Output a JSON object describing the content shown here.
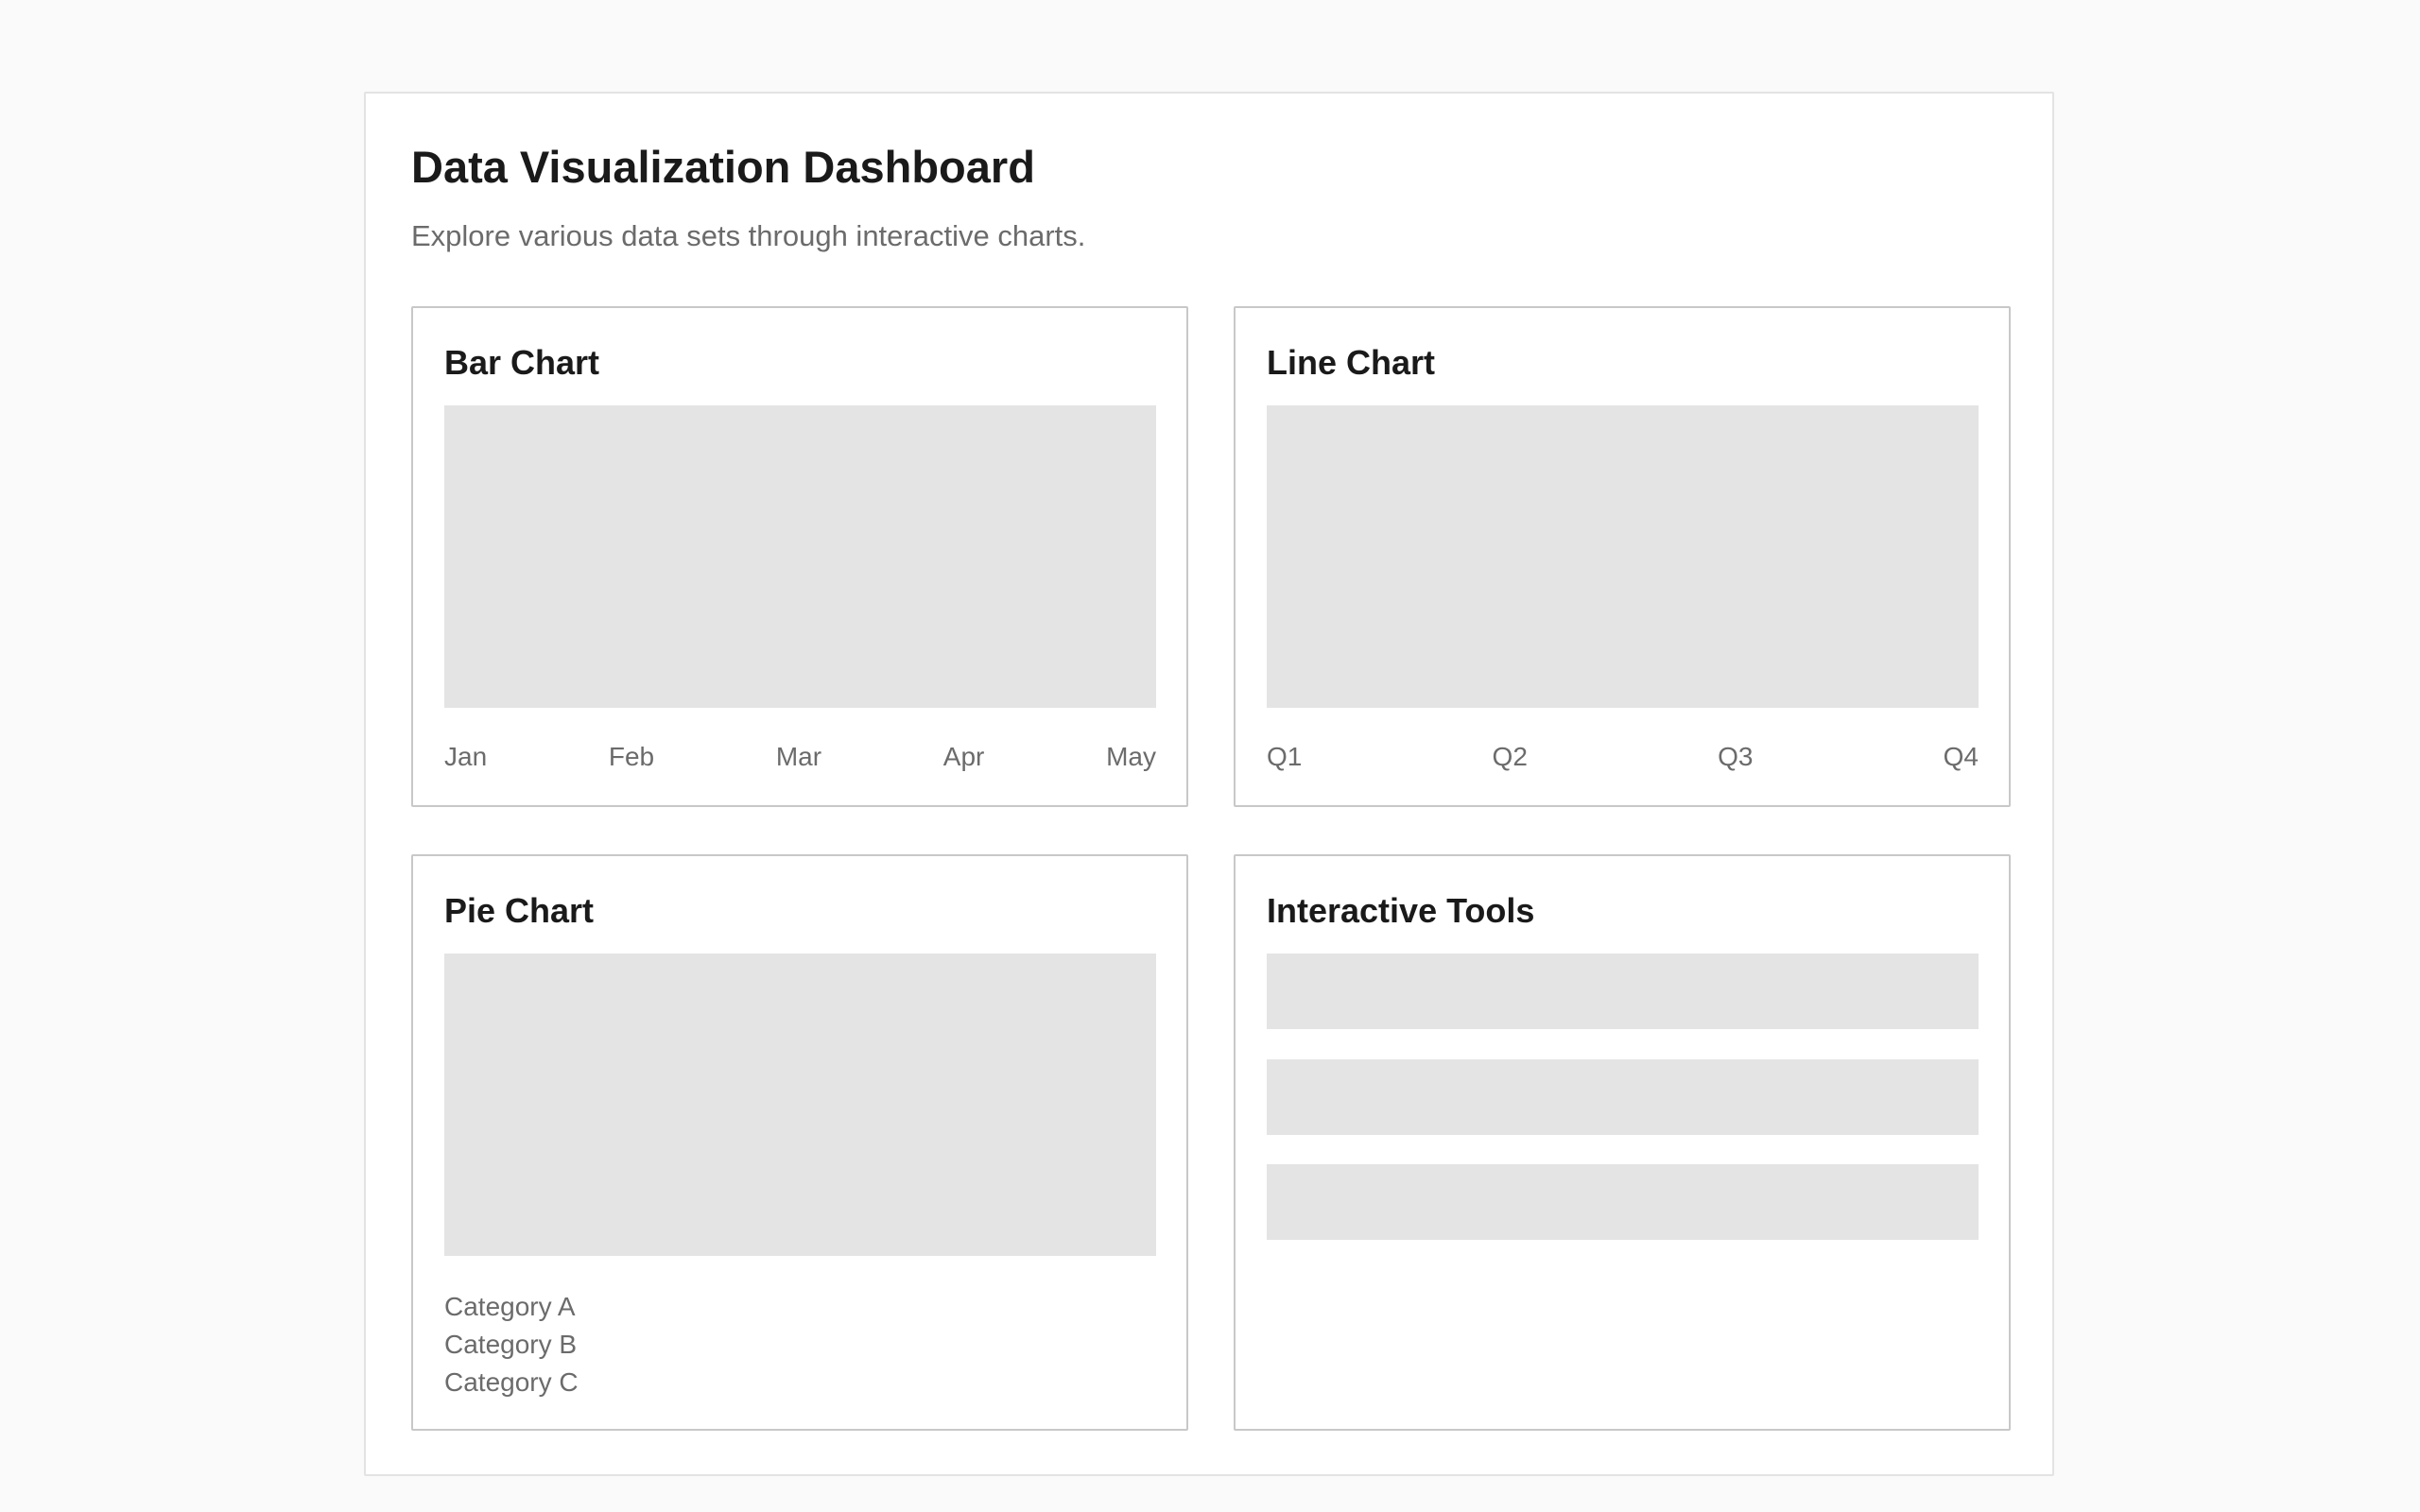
{
  "header": {
    "title": "Data Visualization Dashboard",
    "subtitle": "Explore various data sets through interactive charts."
  },
  "cards": {
    "bar": {
      "title": "Bar Chart",
      "labels": [
        "Jan",
        "Feb",
        "Mar",
        "Apr",
        "May"
      ]
    },
    "line": {
      "title": "Line Chart",
      "labels": [
        "Q1",
        "Q2",
        "Q3",
        "Q4"
      ]
    },
    "pie": {
      "title": "Pie Chart",
      "legend": [
        "Category A",
        "Category B",
        "Category C"
      ]
    },
    "tools": {
      "title": "Interactive Tools"
    }
  },
  "colors": {
    "page_background": "#fafafa",
    "card_border": "#c8c8c8",
    "placeholder": "#e4e4e4",
    "muted_text": "#6b6b6b"
  }
}
